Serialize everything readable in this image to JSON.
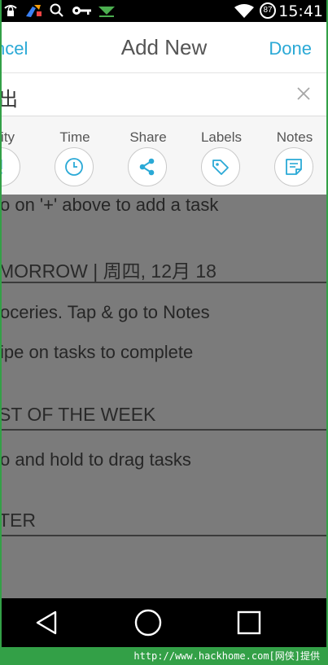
{
  "status_bar": {
    "time": "15:41",
    "battery": "87",
    "icons": [
      "lock-wifi-icon",
      "sweep-icon",
      "search-icon",
      "key-icon",
      "download-icon",
      "wifi-icon",
      "battery-icon"
    ]
  },
  "header": {
    "cancel_label": "ncel",
    "title": "Add New",
    "done_label": "Done"
  },
  "input": {
    "value": "出"
  },
  "options": [
    {
      "label": "ority",
      "icon": "priority-icon"
    },
    {
      "label": "Time",
      "icon": "clock-icon"
    },
    {
      "label": "Share",
      "icon": "share-icon"
    },
    {
      "label": "Labels",
      "icon": "tag-icon"
    },
    {
      "label": "Notes",
      "icon": "notes-icon"
    }
  ],
  "list": {
    "hint_top": "o on '+' above to add a task",
    "section_tomorrow": "MORROW | 周四, 12月 18",
    "item_groceries": "oceries. Tap & go to Notes",
    "item_swipe": "ipe on tasks to complete",
    "section_week": "ST OF THE WEEK",
    "item_drag": "o and hold to drag tasks",
    "section_later": "TER"
  },
  "watermark": "http://www.hackhome.com[网侠]提供",
  "colors": {
    "accent": "#2aa9d6",
    "overlay": "#7b7b7b",
    "frame": "#33a047"
  }
}
